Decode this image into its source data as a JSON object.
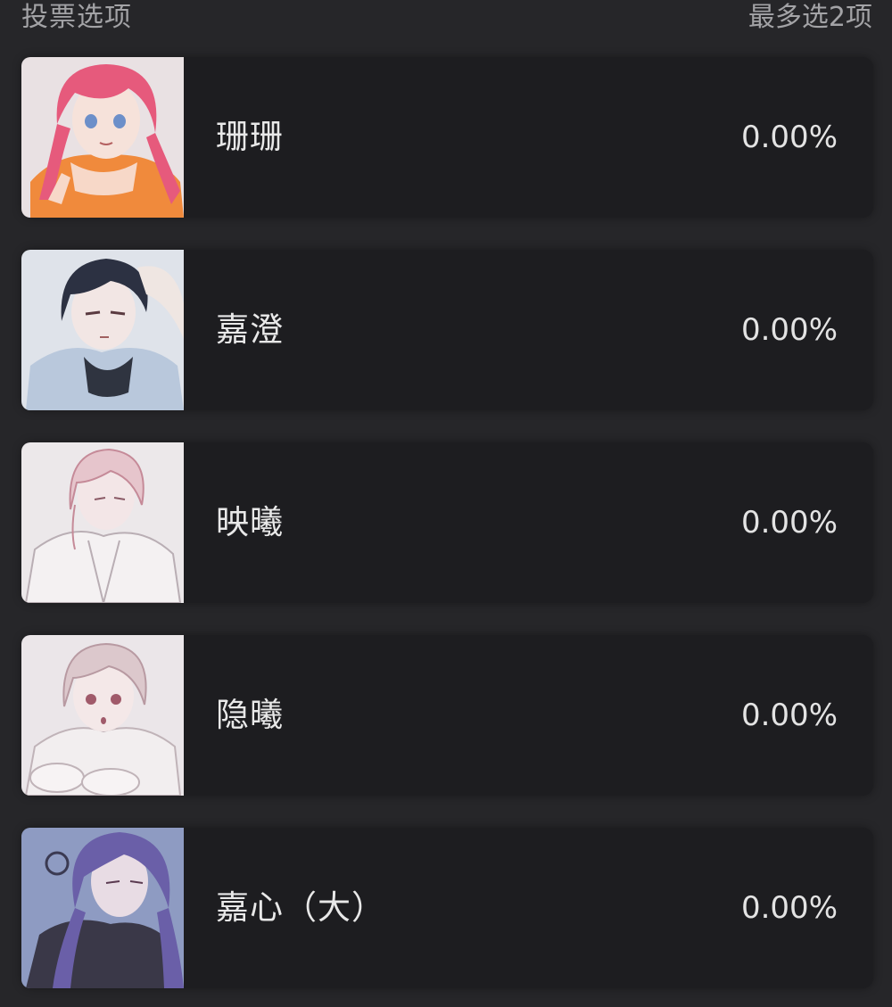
{
  "header": {
    "title": "投票选项",
    "limit": "最多选2项"
  },
  "options": [
    {
      "name": "珊珊",
      "percent": "0.00%",
      "avatar": "character-red-hair-avatar"
    },
    {
      "name": "嘉澄",
      "percent": "0.00%",
      "avatar": "character-dark-hair-avatar"
    },
    {
      "name": "映曦",
      "percent": "0.00%",
      "avatar": "character-pink-sketch-avatar"
    },
    {
      "name": "隐曦",
      "percent": "0.00%",
      "avatar": "character-white-hair-avatar"
    },
    {
      "name": "嘉心（大）",
      "percent": "0.00%",
      "avatar": "character-purple-hair-avatar"
    }
  ],
  "colors": {
    "background": "#262629",
    "card": "#1d1d20",
    "muted_text": "#a3a3a6",
    "text": "#e8e8e8"
  }
}
